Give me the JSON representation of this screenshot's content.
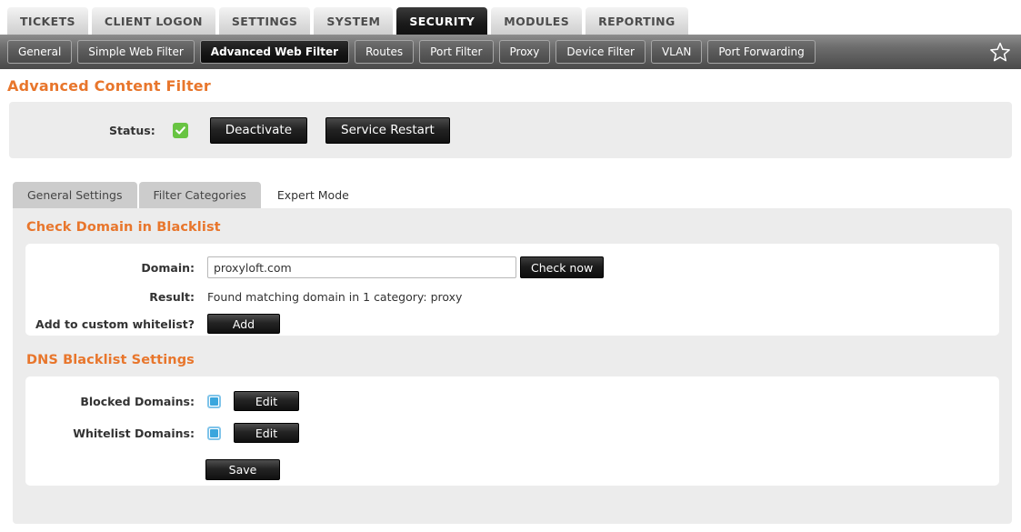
{
  "topnav": {
    "items": [
      {
        "label": "TICKETS",
        "active": false
      },
      {
        "label": "CLIENT LOGON",
        "active": false
      },
      {
        "label": "SETTINGS",
        "active": false
      },
      {
        "label": "SYSTEM",
        "active": false
      },
      {
        "label": "SECURITY",
        "active": true
      },
      {
        "label": "MODULES",
        "active": false
      },
      {
        "label": "REPORTING",
        "active": false
      }
    ]
  },
  "subnav": {
    "items": [
      {
        "label": "General",
        "active": false
      },
      {
        "label": "Simple Web Filter",
        "active": false
      },
      {
        "label": "Advanced Web Filter",
        "active": true
      },
      {
        "label": "Routes",
        "active": false
      },
      {
        "label": "Port Filter",
        "active": false
      },
      {
        "label": "Proxy",
        "active": false
      },
      {
        "label": "Device Filter",
        "active": false
      },
      {
        "label": "VLAN",
        "active": false
      },
      {
        "label": "Port Forwarding",
        "active": false
      }
    ],
    "favorite_icon": "star-outline-icon"
  },
  "page": {
    "title": "Advanced Content Filter"
  },
  "status_bar": {
    "label": "Status:",
    "enabled": true,
    "check_icon": "check-icon",
    "deactivate_label": "Deactivate",
    "service_restart_label": "Service Restart"
  },
  "tabs": [
    {
      "label": "General Settings",
      "active": false
    },
    {
      "label": "Filter Categories",
      "active": false
    },
    {
      "label": "Expert Mode",
      "active": true
    }
  ],
  "check_domain": {
    "heading": "Check Domain in Blacklist",
    "domain_label": "Domain:",
    "domain_value": "proxyloft.com",
    "domain_placeholder": "",
    "check_now_label": "Check now",
    "result_label": "Result:",
    "result_value": "Found matching domain in 1 category: proxy",
    "whitelist_label": "Add to custom whitelist?",
    "add_label": "Add"
  },
  "dns_blacklist": {
    "heading": "DNS Blacklist Settings",
    "blocked_label": "Blocked Domains:",
    "blocked_checked": true,
    "blocked_edit_label": "Edit",
    "whitelist_label": "Whitelist Domains:",
    "whitelist_checked": true,
    "whitelist_edit_label": "Edit",
    "save_label": "Save"
  },
  "colors": {
    "accent_orange": "#e8762c",
    "status_green": "#68c442",
    "checkbox_blue": "#3aa6dd",
    "panel_gray": "#ececec"
  }
}
